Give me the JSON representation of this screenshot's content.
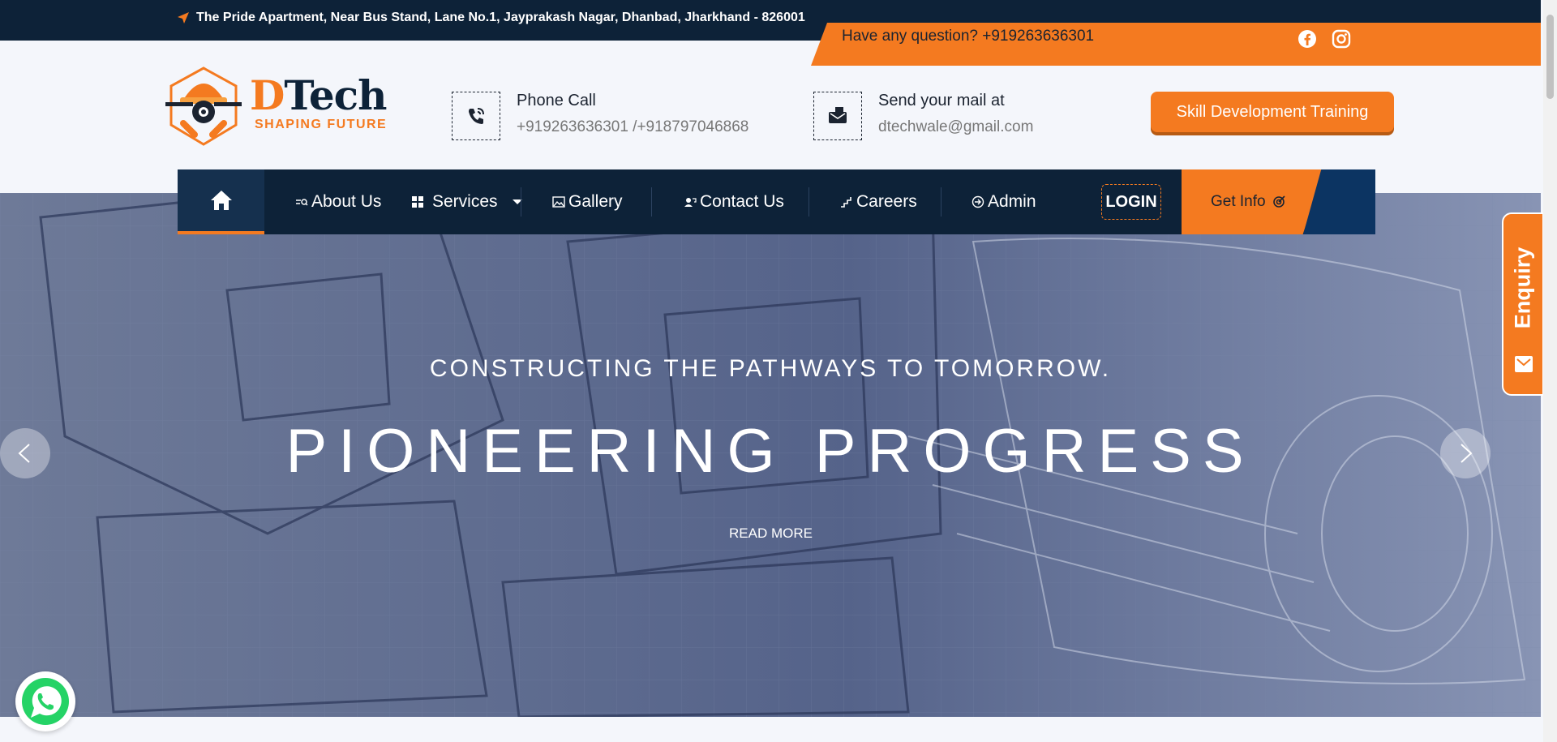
{
  "topbar": {
    "address": "The Pride Apartment, Near Bus Stand, Lane No.1, Jayprakash Nagar, Dhanbad, Jharkhand - 826001",
    "question": "Have any question? +919263636301",
    "social": [
      "facebook-icon",
      "instagram-icon"
    ]
  },
  "logo": {
    "brand_initial": "D",
    "brand_rest": "Tech",
    "tagline": "SHAPING FUTURE"
  },
  "header": {
    "phone_title": "Phone Call",
    "phone_numbers": "+919263636301 /+918797046868",
    "mail_title": "Send your mail at",
    "mail_address": "dtechwale@gmail.com",
    "skill_button": "Skill Development Training"
  },
  "nav": {
    "items": [
      {
        "label": "About Us",
        "icon": "about-icon"
      },
      {
        "label": "Services",
        "icon": "grid-icon"
      },
      {
        "label": "Gallery",
        "icon": "gallery-icon"
      },
      {
        "label": "Contact Us",
        "icon": "contact-icon"
      },
      {
        "label": "Careers",
        "icon": "careers-icon"
      },
      {
        "label": "Admin",
        "icon": "admin-icon"
      }
    ],
    "login": "LOGIN",
    "get_info": "Get Info"
  },
  "hero": {
    "subtitle": "CONSTRUCTING THE PATHWAYS TO TOMORROW.",
    "title": "PIONEERING PROGRESS",
    "read_more": "READ MORE"
  },
  "enquiry": {
    "label": "Enquiry"
  },
  "colors": {
    "navy": "#0d2238",
    "orange": "#f47a20",
    "hero": "#4b5a80"
  }
}
